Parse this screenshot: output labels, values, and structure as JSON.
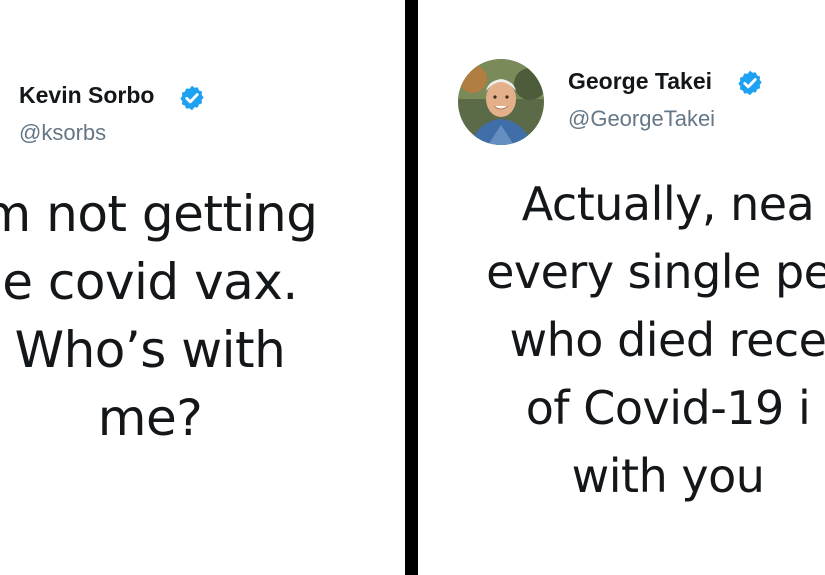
{
  "left_tweet": {
    "display_name": "Kevin Sorbo",
    "handle": "@ksorbs",
    "text_lines": [
      "m not getting",
      "e covid vax.",
      "Who’s with",
      "me?"
    ]
  },
  "right_tweet": {
    "display_name": "George Takei",
    "handle": "@GeorgeTakei",
    "text_lines": [
      "Actually, nea",
      "every single per",
      "who died rece",
      "of Covid-19 i",
      "with you"
    ]
  },
  "colors": {
    "verified_badge": "#1da1f2",
    "divider": "#000000",
    "text": "#14171a",
    "handle": "#657786"
  },
  "icons": [
    "verified-badge-icon",
    "avatar"
  ]
}
